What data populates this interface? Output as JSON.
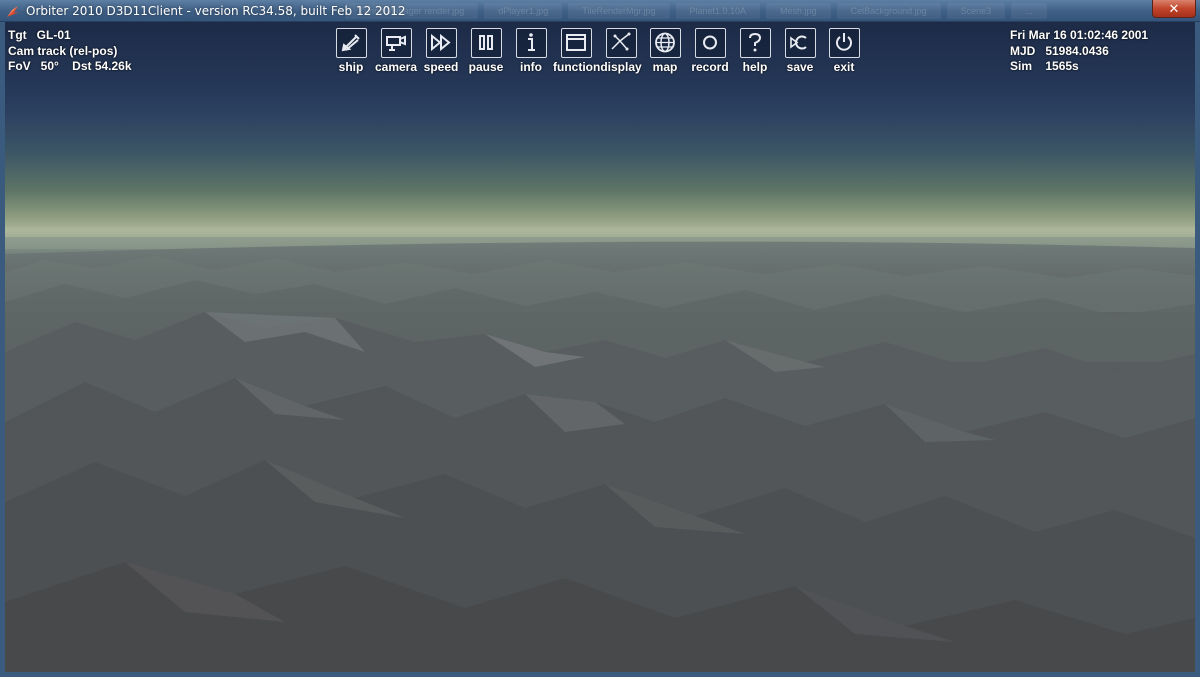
{
  "window": {
    "title": "Orbiter 2010 D3D11Client - version RC34.58, built Feb 12 2012",
    "close_glyph": "✕",
    "background_tabs": [
      "TunnelManager render.jpg",
      "dPlayer1.jpg",
      "TileRenderMgr.jpg",
      "Planet1.0.10A",
      "Mesh.jpg",
      "CelBackground.jpg",
      "Scene3",
      "..."
    ]
  },
  "hud": {
    "target_line": "Tgt   GL-01",
    "camera_line": "Cam track (rel-pos)",
    "fov_line": "FoV   50°    Dst 54.26k",
    "date_line": "Fri Mar 16 01:02:46 2001",
    "mjd_line": "MJD   51984.0436",
    "sim_line": "Sim    1565s"
  },
  "toolbar": [
    {
      "label": "ship",
      "icon": "ship-icon"
    },
    {
      "label": "camera",
      "icon": "camera-icon"
    },
    {
      "label": "speed",
      "icon": "fast-forward-icon"
    },
    {
      "label": "pause",
      "icon": "pause-icon"
    },
    {
      "label": "info",
      "icon": "info-icon"
    },
    {
      "label": "function",
      "icon": "window-icon"
    },
    {
      "label": "display",
      "icon": "display-icon"
    },
    {
      "label": "map",
      "icon": "globe-icon"
    },
    {
      "label": "record",
      "icon": "record-icon"
    },
    {
      "label": "help",
      "icon": "question-icon"
    },
    {
      "label": "save",
      "icon": "save-icon"
    },
    {
      "label": "exit",
      "icon": "power-icon"
    }
  ],
  "colors": {
    "sky_top": "#1d2b47",
    "horizon_glow": "#a9b397",
    "terrain": "#4b4e50",
    "titlebar": "#3f5f85",
    "close_button": "#c1452b"
  }
}
